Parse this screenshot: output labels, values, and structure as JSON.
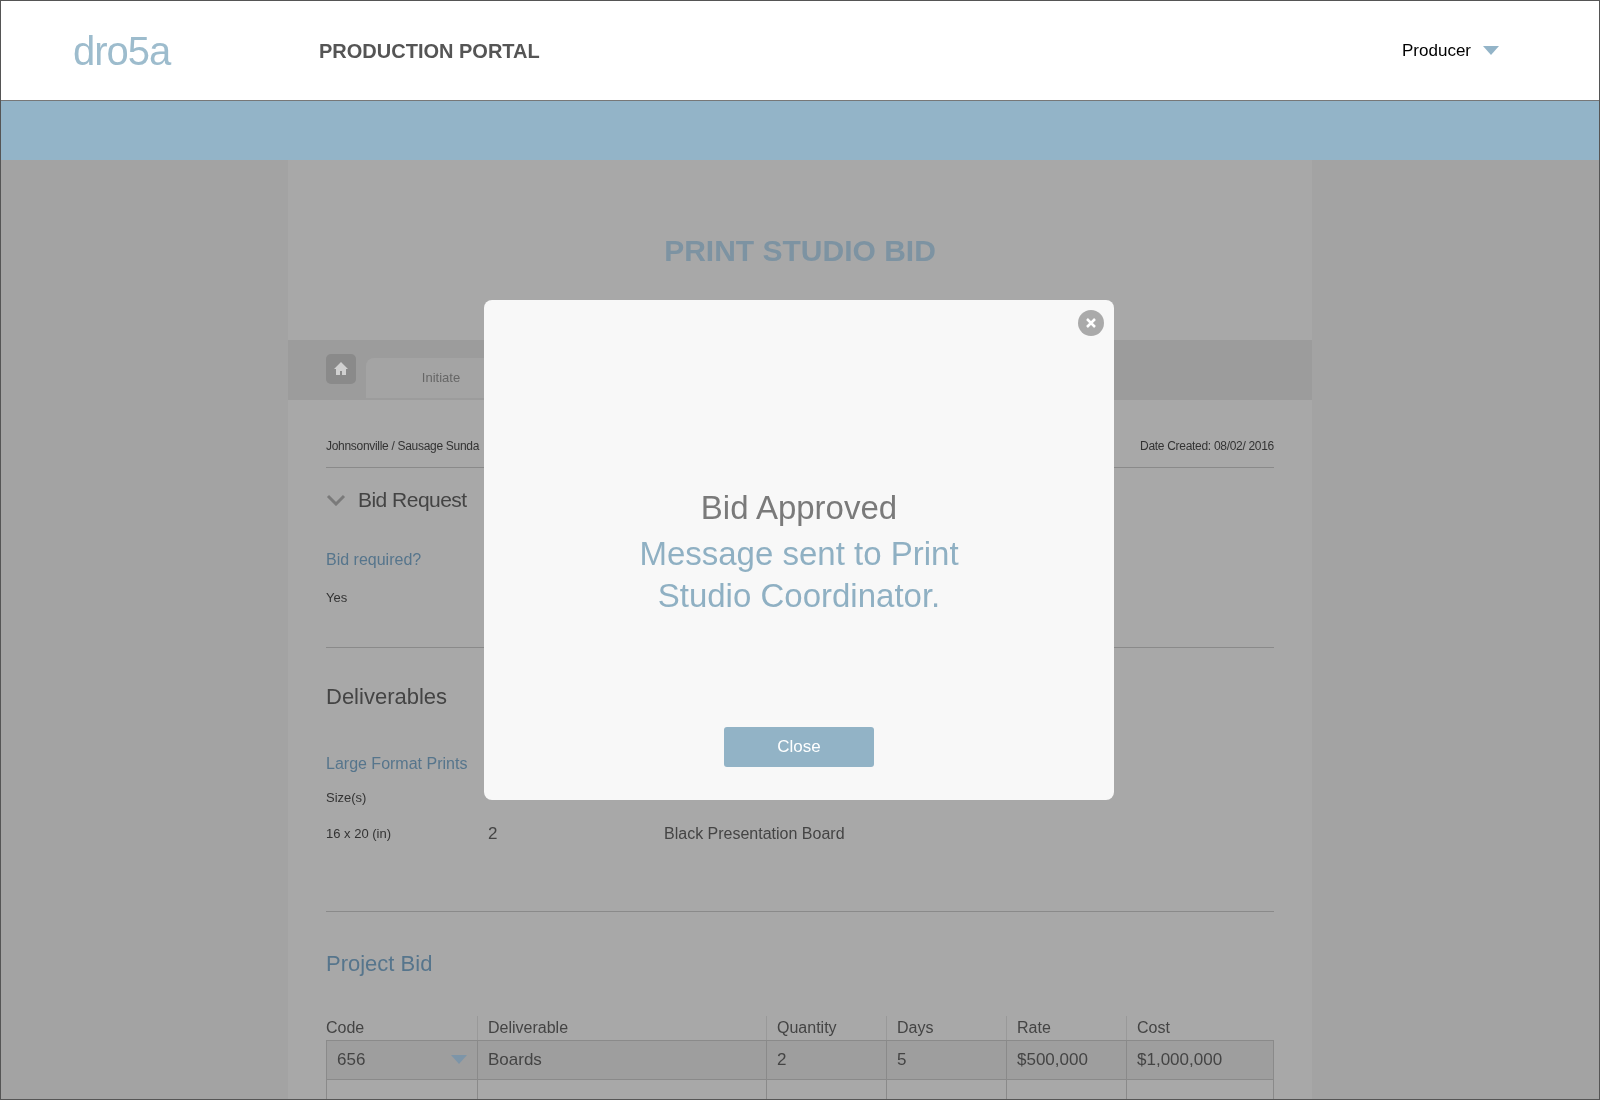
{
  "header": {
    "logo": "dro5a",
    "title": "PRODUCTION PORTAL",
    "user_menu": "Producer"
  },
  "page": {
    "title": "PRINT STUDIO BID",
    "tabs": [
      {
        "label": "Initiate",
        "selected": false
      }
    ],
    "breadcrumb": "Johnsonville / Sausage Sunda",
    "date_created": "Date Created: 08/02/ 2016",
    "bid_request": {
      "title": "Bid Request",
      "expanded": true,
      "question": "Bid required?",
      "answer": "Yes"
    },
    "deliverables": {
      "title": "Deliverables",
      "group": "Large Format Prints",
      "size_label": "Size(s)",
      "size": "16 x 20 (in)",
      "quantity": "2",
      "mounting": "Black Presentation Board"
    },
    "project_bid": {
      "title": "Project Bid",
      "columns": [
        "Code",
        "Deliverable",
        "Quantity",
        "Days",
        "Rate",
        "Cost"
      ],
      "rows": [
        [
          "656",
          "Boards",
          "2",
          "5",
          "$500,000",
          "$1,000,000"
        ],
        [
          "",
          "",
          "",
          "",
          "",
          ""
        ]
      ]
    }
  },
  "modal": {
    "heading": "Bid Approved",
    "message": "Message sent to Print Studio Coordinator.",
    "button": "Close"
  }
}
